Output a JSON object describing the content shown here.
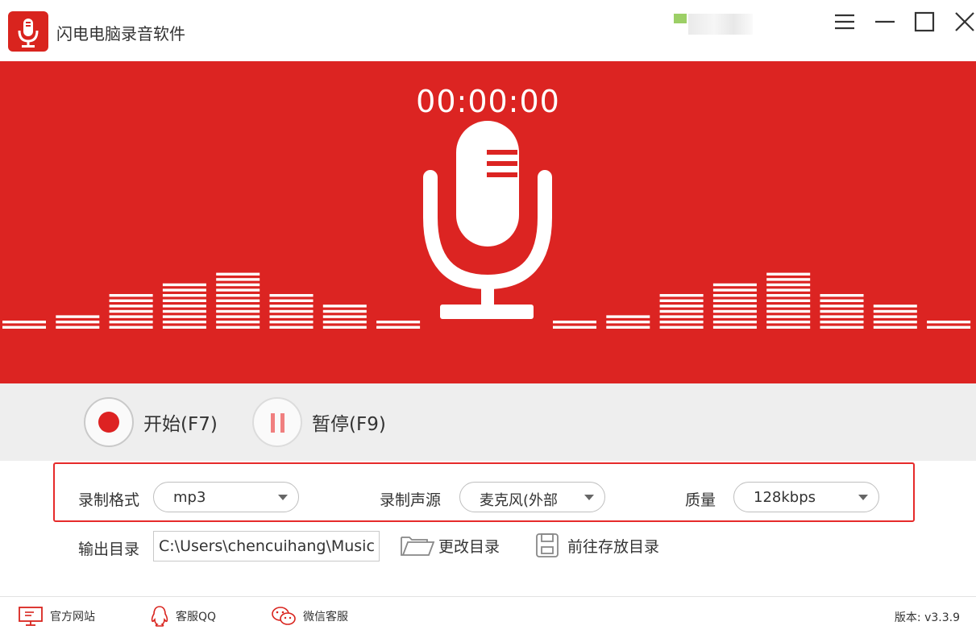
{
  "app": {
    "title": "闪电电脑录音软件"
  },
  "window_controls": [
    "menu-icon",
    "minimize-icon",
    "maximize-icon",
    "close-icon"
  ],
  "hero": {
    "timer": "00:00:00",
    "background_color": "#dc2422",
    "equalizer_left_levels": [
      2,
      3,
      7,
      9,
      11,
      7,
      5,
      2
    ],
    "equalizer_right_levels": [
      2,
      3,
      7,
      9,
      11,
      7,
      5,
      2
    ]
  },
  "controls": {
    "start_label": "开始(F7)",
    "pause_label": "暂停(F9)"
  },
  "settings": {
    "format_label": "录制格式",
    "format_value": "mp3",
    "source_label": "录制声源",
    "source_value": "麦克风(外部",
    "quality_label": "质量",
    "quality_value": "128kbps"
  },
  "output": {
    "label": "输出目录",
    "path": "C:\\Users\\chencuihang\\Music",
    "change_label": "更改目录",
    "open_label": "前往存放目录"
  },
  "footer": {
    "website_label": "官方网站",
    "qq_label": "客服QQ",
    "wechat_label": "微信客服",
    "version": "版本: v3.3.9"
  },
  "colors": {
    "accent": "#dc2422",
    "highlight_border": "#e62a2a"
  }
}
